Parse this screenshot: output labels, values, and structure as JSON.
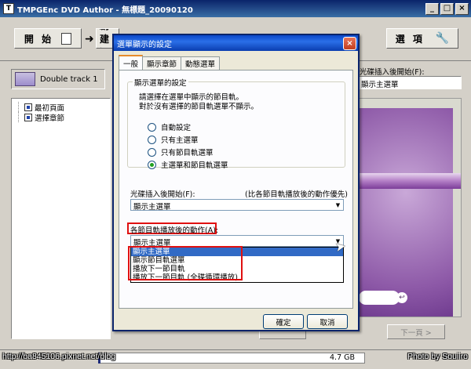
{
  "app": {
    "title": "TMPGEnc DVD Author - 無標題_20090120",
    "icon": "T"
  },
  "window_buttons": {
    "minimize": "_",
    "maximize": "□",
    "close": "×"
  },
  "toolbar": {
    "open_label": "開 始",
    "create_label": "創 建 源",
    "options_label": "選 項",
    "arrow": "➜",
    "wrench_icon": "🔧"
  },
  "track": {
    "label": "Double track 1"
  },
  "tree": {
    "items": [
      "最初頁面",
      "選擇章節"
    ]
  },
  "right_panel": {
    "start_label": "光碟插入後開始(F):",
    "start_value": "顯示主選單"
  },
  "preview": {
    "circle_glyph": "↩"
  },
  "bottom": {
    "next_label": "下一頁 >",
    "capacity_text": "4.7 GB",
    "capacity_fill_fraction": 0.01
  },
  "watermarks": {
    "left": "http://ba845106.pixnet.net/blog",
    "right": "Photo by Souiiro"
  },
  "dialog": {
    "title": "選單顯示的設定",
    "close": "×",
    "tabs": [
      "一般",
      "顯示章節",
      "動態選單"
    ],
    "group_label": "顯示選單的設定",
    "group_desc_line1": "請選擇在選單中顯示的節目軌。",
    "group_desc_line2": "對於沒有選擇的節目軌選單不顯示。",
    "radios": [
      {
        "label": "自動設定",
        "checked": false
      },
      {
        "label": "只有主選單",
        "checked": false
      },
      {
        "label": "只有節目軌選單",
        "checked": false
      },
      {
        "label": "主選單和節目軌選單",
        "checked": true
      }
    ],
    "start_label": "光碟插入後開始(F):",
    "start_note": "(比各節目軌播放後的動作優先)",
    "start_value": "顯示主選單",
    "after_label": "各節目軌播放後的動作(A):",
    "after_value": "顯示主選單",
    "dropdown_options": [
      "顯示主選單",
      "顯示節目軌選單",
      "播放下一節目軌",
      "播放下一節目軌 (全碟循環播放)"
    ],
    "ok_label": "確定",
    "cancel_label": "取消",
    "arrow_glyph": "▼"
  },
  "colors": {
    "title_blue": "#0a246a",
    "xp_blue": "#2a6fe8",
    "highlight": "#e01010",
    "selection": "#316ac5"
  }
}
